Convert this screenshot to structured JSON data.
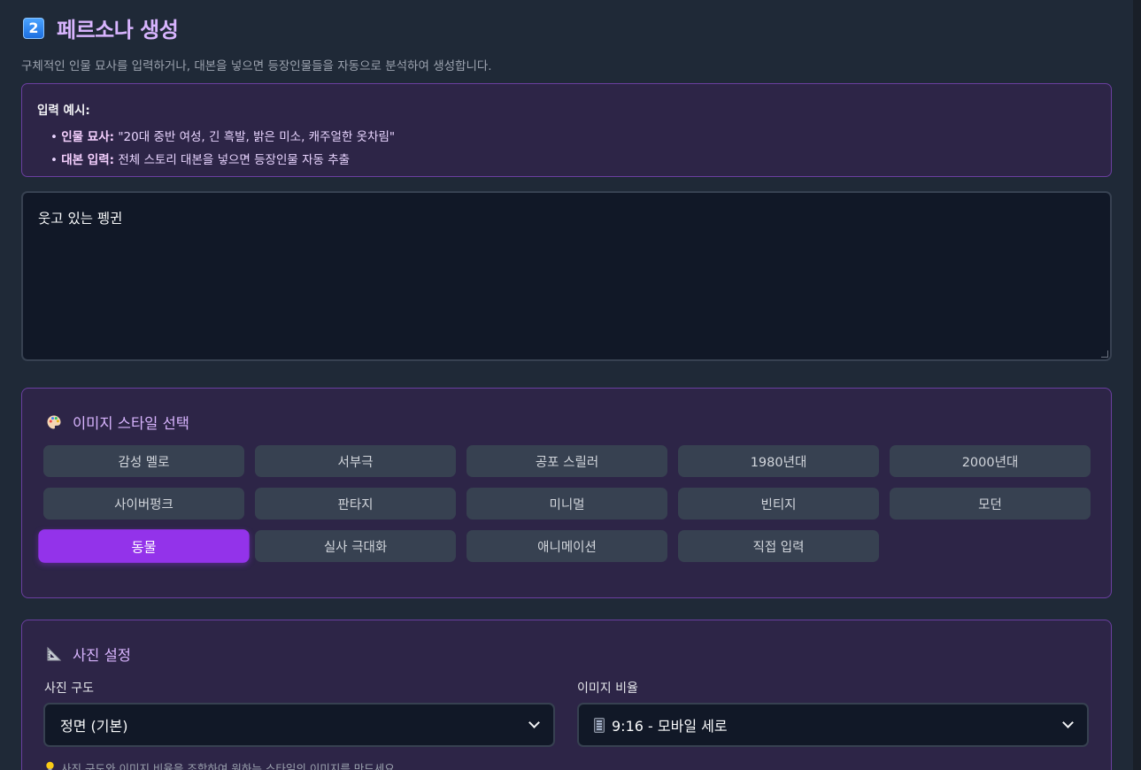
{
  "header": {
    "badge": "2",
    "title": "페르소나 생성",
    "subtitle": "구체적인 인물 묘사를 입력하거나, 대본을 넣으면 등장인물들을 자동으로 분석하여 생성합니다."
  },
  "example": {
    "heading": "입력 예시:",
    "items": [
      {
        "label": "인물 묘사:",
        "text": "\"20대 중반 여성, 긴 흑발, 밝은 미소, 캐주얼한 옷차림\""
      },
      {
        "label": "대본 입력:",
        "text": "전체 스토리 대본을 넣으면 등장인물 자동 추출"
      }
    ]
  },
  "input": {
    "value": "웃고 있는 펭귄"
  },
  "style_panel": {
    "heading": "이미지 스타일 선택",
    "buttons": [
      "감성 멜로",
      "서부극",
      "공포 스릴러",
      "1980년대",
      "2000년대",
      "사이버펑크",
      "판타지",
      "미니멀",
      "빈티지",
      "모던",
      "동물",
      "실사 극대화",
      "애니메이션",
      "직접 입력"
    ],
    "selected": "동물"
  },
  "photo_panel": {
    "heading": "사진 설정",
    "composition": {
      "label": "사진 구도",
      "value": "정면 (기본)"
    },
    "ratio": {
      "label": "이미지 비율",
      "value": "9:16 - 모바일 세로"
    },
    "hint": "사진 구도와 이미지 비율을 조합하여 원하는 스타일의 이미지를 만드세요."
  },
  "colors": {
    "accent": "#9333ea",
    "title": "#d8b4fe",
    "panel": "#2d2547"
  }
}
